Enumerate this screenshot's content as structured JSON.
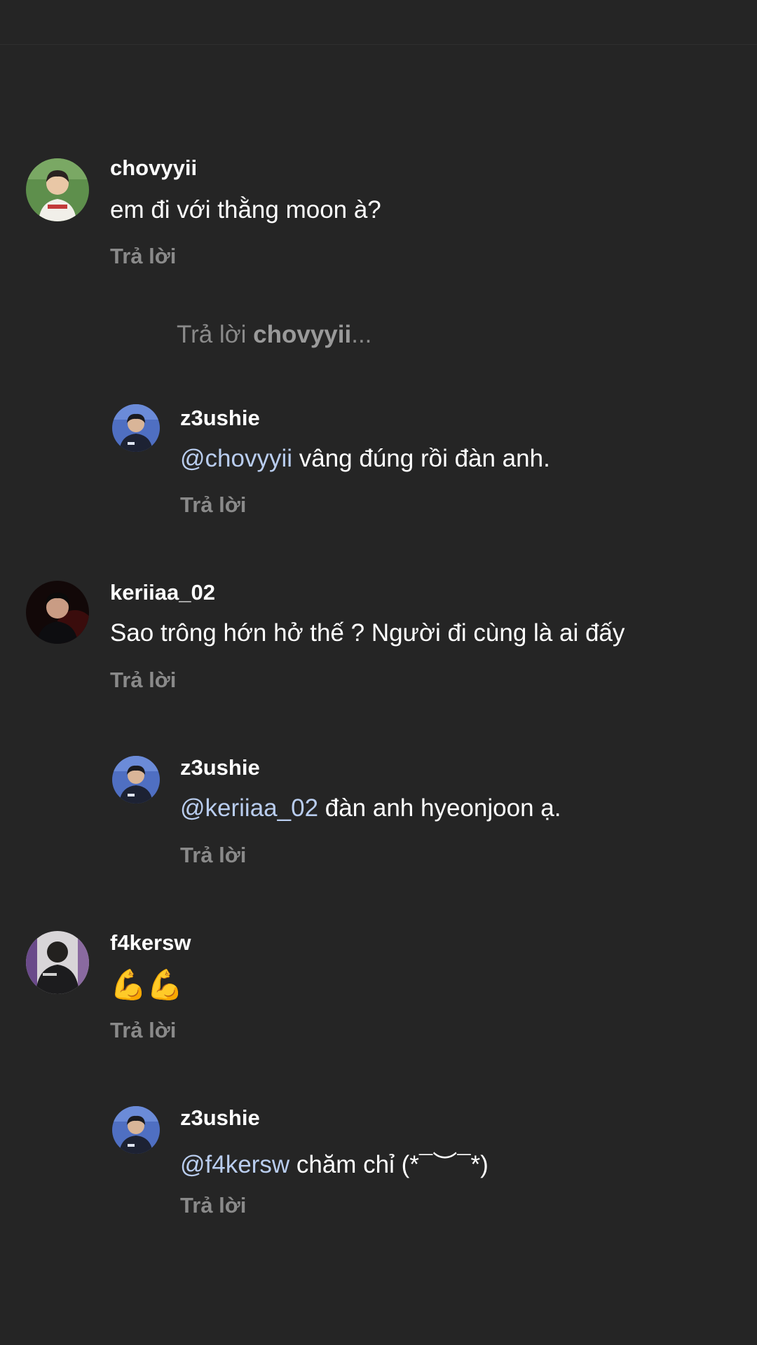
{
  "reply_prompt": {
    "prefix": "Trả lời ",
    "target": "chovyyii",
    "suffix": "..."
  },
  "comments": [
    {
      "username": "chovyyii",
      "text": "em đi với thằng moon à?",
      "reply_label": "Trả lời"
    },
    {
      "username": "z3ushie",
      "mention": "@chovyyii",
      "text": " vâng đúng rồi đàn anh.",
      "reply_label": "Trả lời"
    },
    {
      "username": "keriiaa_02",
      "text": "Sao trông hớn hở thế ? Người đi cùng là ai đấy",
      "reply_label": "Trả lời"
    },
    {
      "username": "z3ushie",
      "mention": "@keriiaa_02",
      "text": " đàn anh hyeonjoon ạ.",
      "reply_label": "Trả lời"
    },
    {
      "username": "f4kersw",
      "text": "💪💪",
      "reply_label": "Trả lời"
    },
    {
      "username": "z3ushie",
      "mention": "@f4kersw",
      "text": " chăm chỉ (*¯︶¯*)",
      "reply_label": "Trả lời"
    }
  ],
  "colors": {
    "background": "#252525",
    "text": "#ffffff",
    "muted": "#8a8a8a",
    "mention": "#b9cdef"
  },
  "icons": [
    "avatar-chovyyii",
    "avatar-z3ushie",
    "avatar-keriiaa_02",
    "avatar-f4kersw"
  ]
}
